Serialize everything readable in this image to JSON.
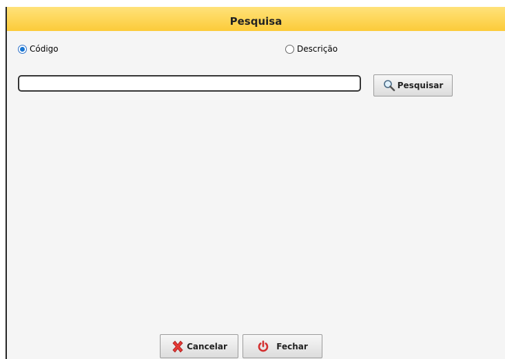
{
  "dialog": {
    "title": "Pesquisa"
  },
  "radios": {
    "codigo_label": "Código",
    "descricao_label": "Descrição",
    "selected": "codigo"
  },
  "search": {
    "value": "",
    "button_label": "Pesquisar",
    "button_icon": "magnifier-icon"
  },
  "footer": {
    "cancel_label": "Cancelar",
    "cancel_icon": "cancel-x-icon",
    "close_label": "Fechar",
    "close_icon": "power-icon"
  },
  "colors": {
    "title_bar": "#fccb39",
    "body_bg": "#f5f5f5",
    "radio_selected": "#1976d2",
    "cancel_icon": "#e53935",
    "close_icon": "#d32f2f"
  }
}
